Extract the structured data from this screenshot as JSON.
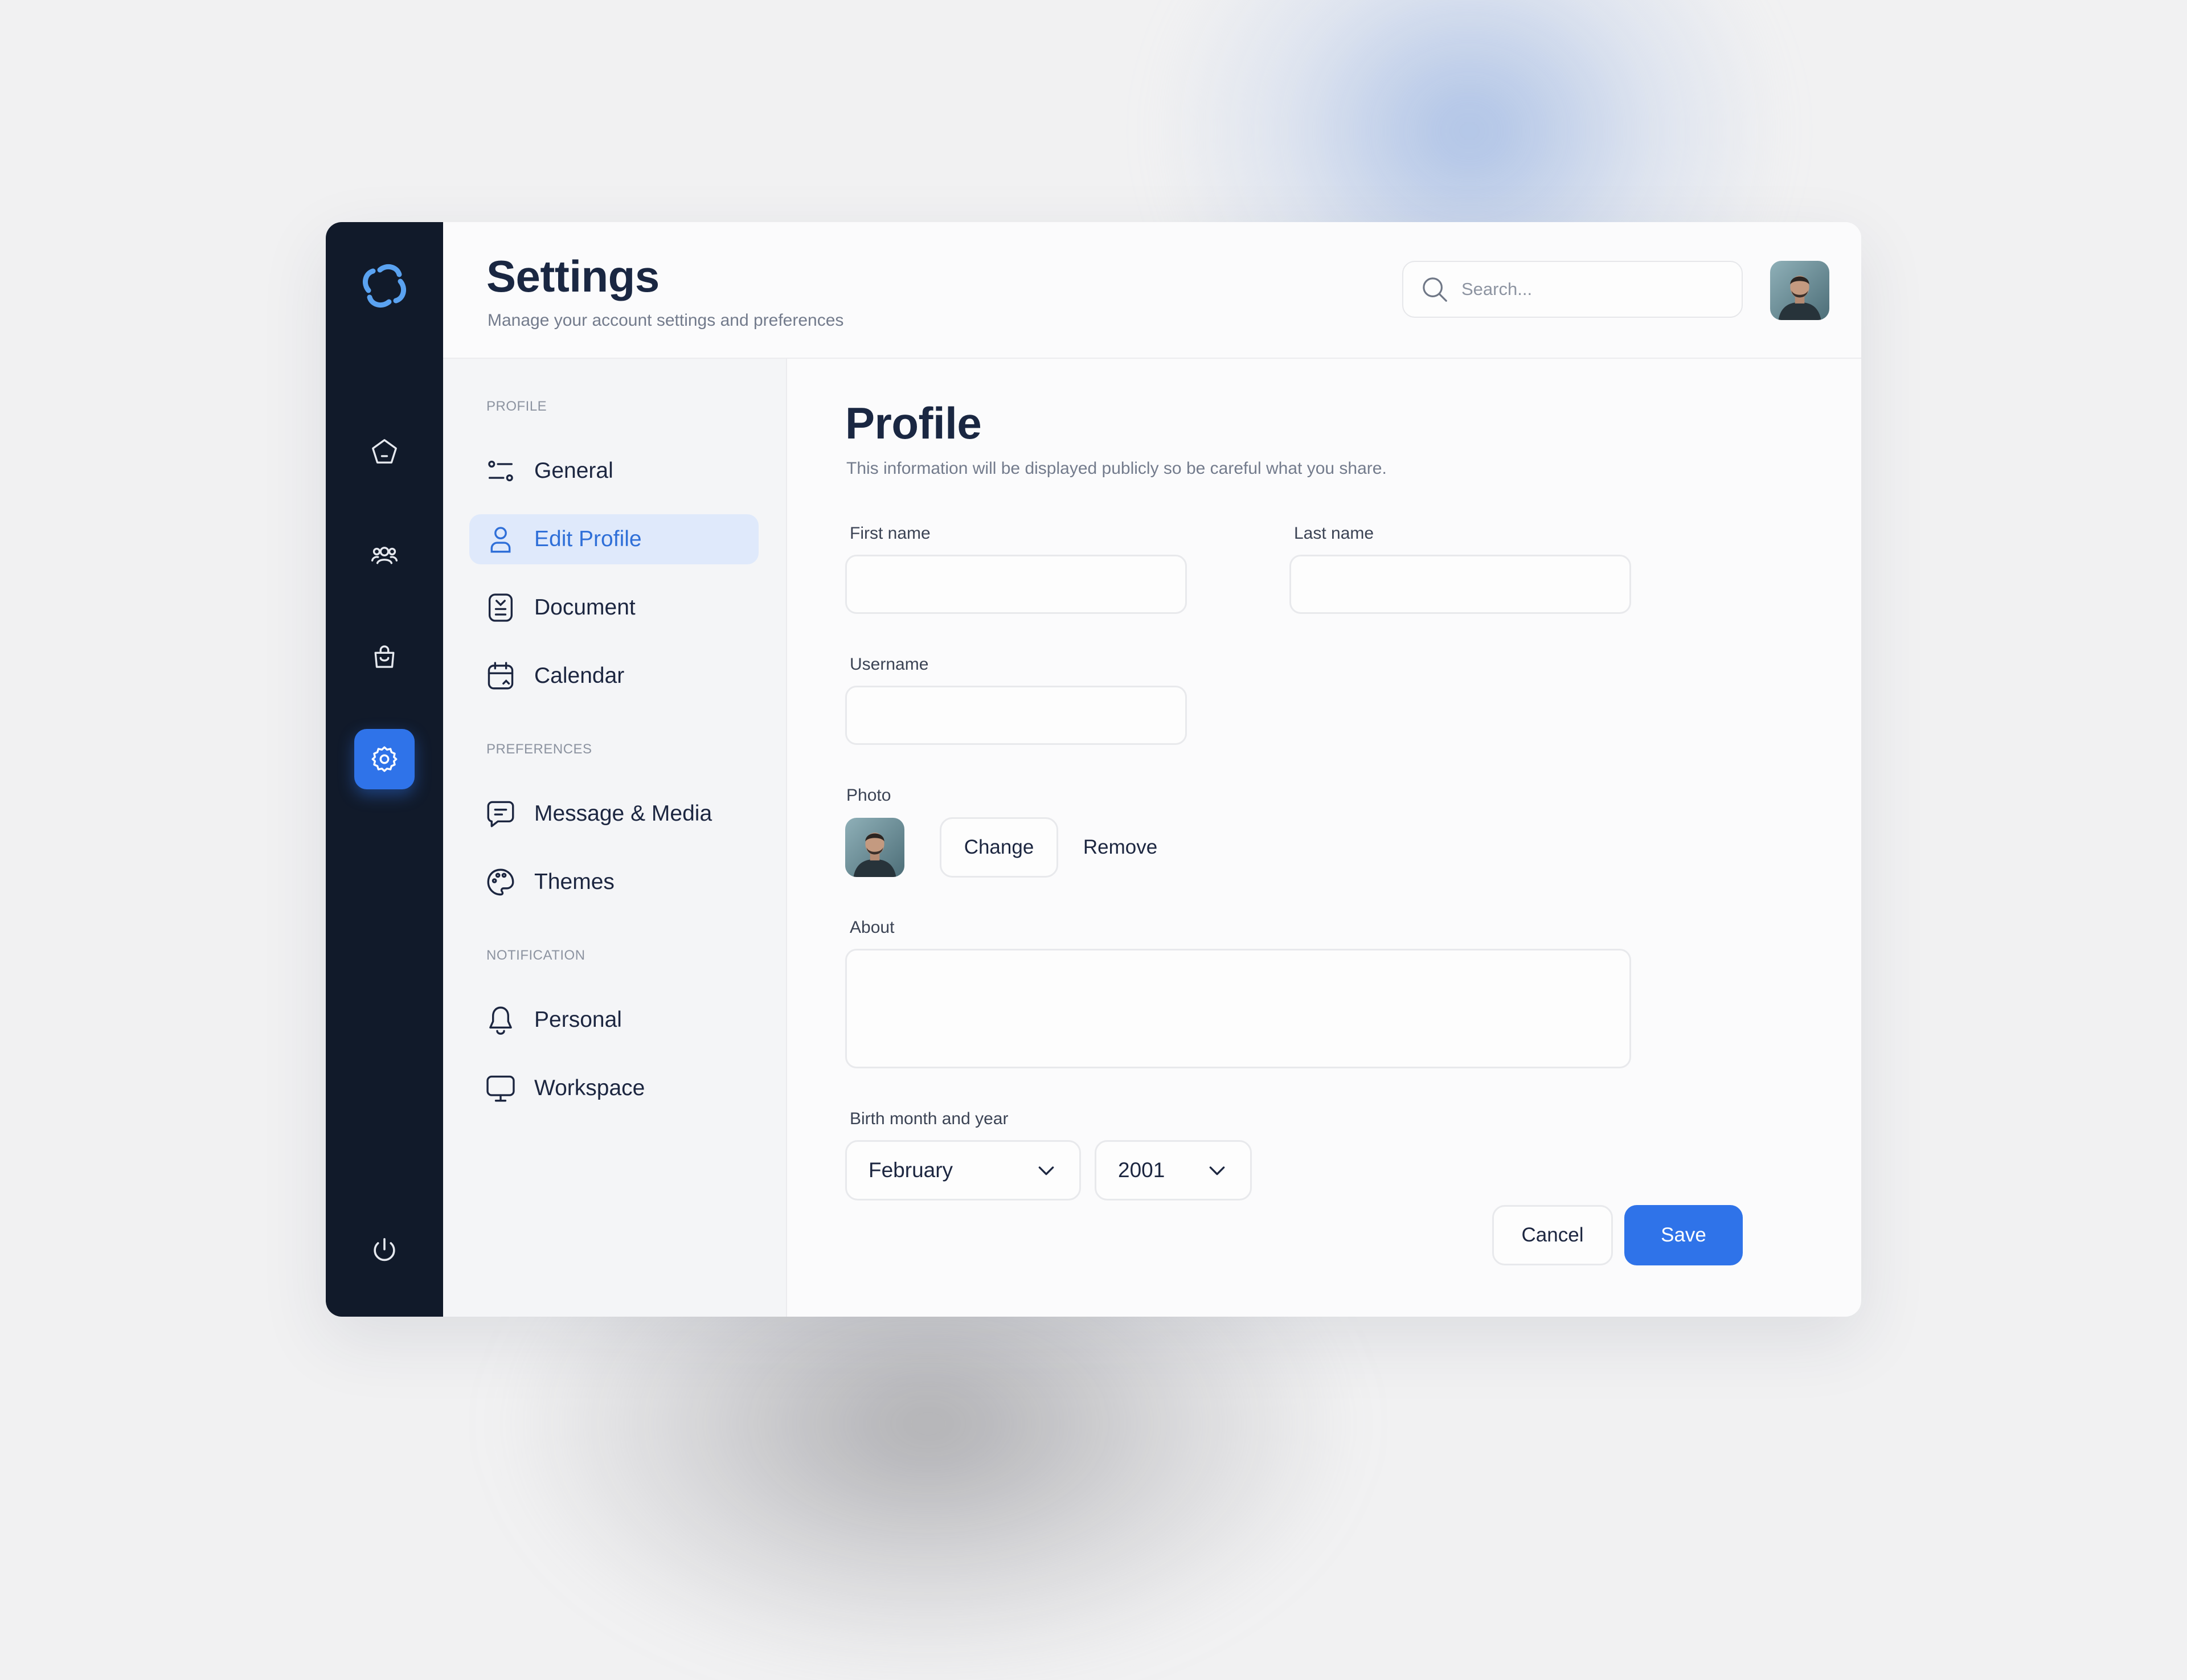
{
  "header": {
    "title": "Settings",
    "subtitle": "Manage your account settings and preferences",
    "search_placeholder": "Search..."
  },
  "rail": {
    "items": [
      {
        "icon": "home-icon"
      },
      {
        "icon": "users-icon"
      },
      {
        "icon": "shopping-bag-icon"
      },
      {
        "icon": "gear-icon",
        "active": true
      },
      {
        "icon": "power-icon"
      }
    ]
  },
  "subnav": {
    "sections": [
      {
        "label": "PROFILE",
        "items": [
          {
            "label": "General",
            "icon": "sliders-icon"
          },
          {
            "label": "Edit Profile",
            "icon": "user-icon",
            "active": true
          },
          {
            "label": "Document",
            "icon": "document-icon"
          },
          {
            "label": "Calendar",
            "icon": "calendar-icon"
          }
        ]
      },
      {
        "label": "PREFERENCES",
        "items": [
          {
            "label": "Message & Media",
            "icon": "message-icon"
          },
          {
            "label": "Themes",
            "icon": "palette-icon"
          }
        ]
      },
      {
        "label": "NOTIFICATION",
        "items": [
          {
            "label": "Personal",
            "icon": "bell-icon"
          },
          {
            "label": "Workspace",
            "icon": "monitor-icon"
          }
        ]
      }
    ]
  },
  "profile": {
    "title": "Profile",
    "description": "This information will be displayed publicly so be careful what you share.",
    "first_name_label": "First name",
    "first_name_value": "",
    "last_name_label": "Last name",
    "last_name_value": "",
    "username_label": "Username",
    "username_value": "",
    "photo_label": "Photo",
    "change_label": "Change",
    "remove_label": "Remove",
    "about_label": "About",
    "about_value": "",
    "birth_label": "Birth month and year",
    "birth_month": "February",
    "birth_year": "2001",
    "cancel_label": "Cancel",
    "save_label": "Save"
  },
  "colors": {
    "accent": "#2f73e9",
    "rail_background": "#111a2a",
    "active_item_background": "#dfe9fb",
    "active_item_text": "#2f6fd8"
  }
}
